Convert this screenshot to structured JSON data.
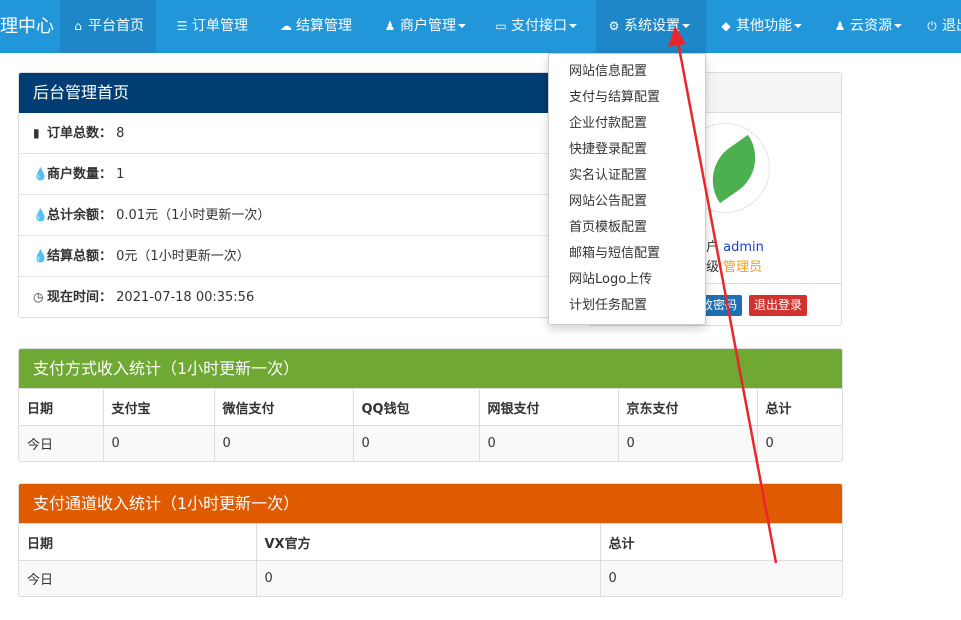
{
  "navbar": {
    "brand": "管理中心",
    "items": [
      {
        "label": "平台首页",
        "icon": "home-icon"
      },
      {
        "label": "订单管理",
        "icon": "list-icon"
      },
      {
        "label": "结算管理",
        "icon": "cloud-icon"
      },
      {
        "label": "商户管理",
        "icon": "user-icon"
      },
      {
        "label": "支付接口",
        "icon": "card-icon"
      },
      {
        "label": "系统设置",
        "icon": "gear-icon"
      },
      {
        "label": "其他功能",
        "icon": "cube-icon"
      },
      {
        "label": "云资源",
        "icon": "user-icon"
      },
      {
        "label": "退出",
        "icon": "power-icon"
      }
    ]
  },
  "dropdown": {
    "items": [
      "网站信息配置",
      "支付与结算配置",
      "企业付款配置",
      "快捷登录配置",
      "实名认证配置",
      "网站公告配置",
      "首页模板配置",
      "邮箱与短信配置",
      "网站Logo上传",
      "计划任务配置"
    ]
  },
  "dashboard": {
    "title": "后台管理首页",
    "rows": [
      {
        "label": "订单总数：",
        "value": "8",
        "icon": "bar-chart-icon"
      },
      {
        "label": "商户数量：",
        "value": "1",
        "icon": "drop-icon"
      },
      {
        "label": "总计余额：",
        "value": "0.01元（1小时更新一次）",
        "icon": "drop-icon"
      },
      {
        "label": "结算总额：",
        "value": "0元（1小时更新一次）",
        "icon": "drop-icon"
      },
      {
        "label": "现在时间：",
        "value": "2021-07-18 00:35:56",
        "icon": "clock-icon"
      }
    ]
  },
  "user_card": {
    "username": "admin",
    "group_prefix": "级",
    "role": "管理员",
    "change_password": "改密码",
    "logout": "退出登录",
    "user_prefix": "户"
  },
  "payment_stats": {
    "title": "支付方式收入统计（1小时更新一次）",
    "headers": [
      "日期",
      "支付宝",
      "微信支付",
      "QQ钱包",
      "网银支付",
      "京东支付",
      "总计"
    ],
    "row": [
      "今日",
      "0",
      "0",
      "0",
      "0",
      "0",
      "0"
    ]
  },
  "channel_stats": {
    "title": "支付通道收入统计（1小时更新一次）",
    "headers": [
      "日期",
      "VX官方",
      "总计"
    ],
    "row": [
      "今日",
      "0",
      "0"
    ]
  },
  "colors": {
    "navbar": "#2196d9",
    "dashboard_header": "#003d73",
    "payment_header": "#6fa833",
    "channel_header": "#e05a00",
    "arrow": "#e8262c"
  }
}
